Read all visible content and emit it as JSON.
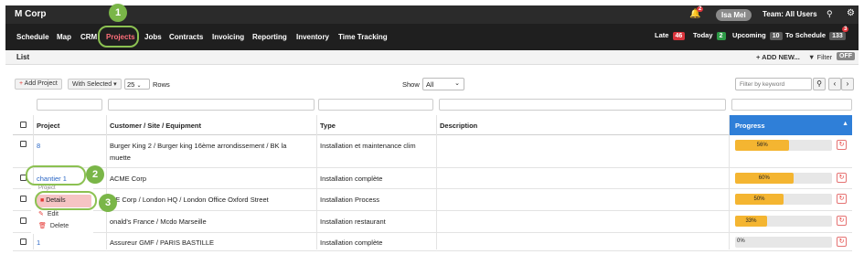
{
  "topbar": {
    "brand": "M Corp",
    "notifications_count": "2",
    "user_name": "Isa Mel",
    "team_label": "Team: All Users"
  },
  "nav": {
    "items": [
      "Schedule",
      "Map",
      "CRM",
      "Projects",
      "Jobs",
      "Contracts",
      "Invoicing",
      "Reporting",
      "Inventory",
      "Time Tracking"
    ],
    "active": "Projects",
    "late_label": "Late",
    "late_count": "46",
    "today_label": "Today",
    "today_count": "2",
    "upcoming_label": "Upcoming",
    "upcoming_count": "10",
    "to_schedule_label": "To Schedule",
    "to_schedule_count": "133",
    "to_schedule_badge": "3"
  },
  "subheader": {
    "title": "List",
    "add_new_label": "+ ADD NEW...",
    "filter_label": "Filter",
    "filter_state": "OFF"
  },
  "toolbar": {
    "add_project_label": "Add Project",
    "with_selected_label": "With Selected",
    "rows_value": "25",
    "rows_label": "Rows",
    "show_label": "Show",
    "show_value": "All",
    "keyword_placeholder": "Filter by keyword"
  },
  "table": {
    "headers": [
      "Project",
      "Customer / Site / Equipment",
      "Type",
      "Description",
      "Progress"
    ],
    "rows": [
      {
        "project": "8",
        "customer_line1": "Burger King 2 / Burger king 16ème arrondissement / BK la",
        "customer_line2": "muette",
        "type": "Installation et maintenance clim",
        "progress": 56,
        "progress_label": "56%"
      },
      {
        "project": "chantier 1",
        "customer_line1": "ACME Corp",
        "customer_line2": "",
        "type": "Installation complète",
        "progress": 60,
        "progress_label": "60%"
      },
      {
        "project": "",
        "customer_line1": "ME Corp / London HQ / London Office Oxford Street",
        "customer_line2": "",
        "type": "Installation Process",
        "progress": 50,
        "progress_label": "50%"
      },
      {
        "project": "",
        "customer_line1": "onald's France / Mcdo Marseille",
        "customer_line2": "",
        "type": "Installation restaurant",
        "progress": 33,
        "progress_label": "33%"
      },
      {
        "project": "1",
        "customer_line1": "Assureur GMF / PARIS BASTILLE",
        "customer_line2": "",
        "type": "Installation complète",
        "progress": 0,
        "progress_label": "0%"
      }
    ]
  },
  "context_menu": {
    "header": "Project",
    "details": "Details",
    "edit": "Edit",
    "delete": "Delete"
  },
  "callouts": [
    "1",
    "2",
    "3"
  ],
  "colors": {
    "topbar": "#2b2b2b",
    "navbar": "#1f1f1f",
    "active_nav": "#ff6f7a",
    "progress_header": "#2f7fd8",
    "progress_fill": "#f4b531",
    "callout": "#7ab648",
    "late_badge": "#d9343c",
    "today_badge": "#2e9b47"
  }
}
